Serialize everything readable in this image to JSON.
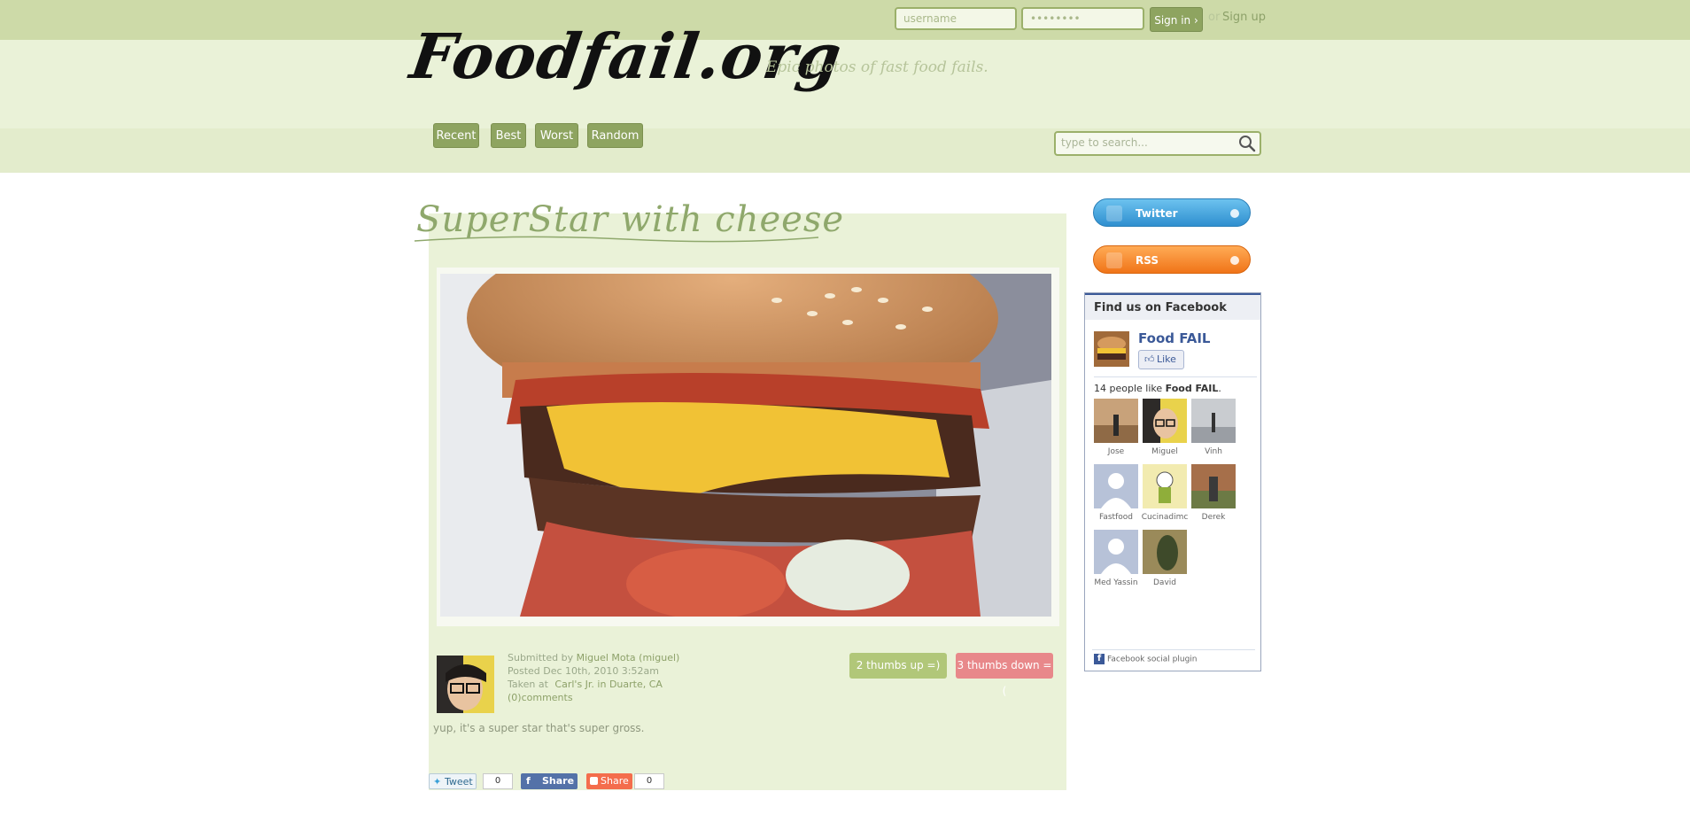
{
  "header": {
    "login": {
      "username_placeholder": "username",
      "password_placeholder": "••••••••",
      "signin_label": "Sign in ›",
      "or_text": "or",
      "signup_label": "Sign up"
    },
    "logo": "Foodfail.org",
    "tagline": "Epic photos of fast food fails.",
    "nav": [
      "Recent",
      "Best",
      "Worst",
      "Random"
    ],
    "search_placeholder": "type to search..."
  },
  "post": {
    "title": "SuperStar with cheese",
    "submitted_by_prefix": "Submitted by",
    "author": "Miguel Mota (miguel)",
    "posted": "Posted Dec 10th, 2010 3:52am",
    "taken_prefix": "Taken at",
    "location": "Carl's Jr. in Duarte, CA",
    "comments": "(0)comments",
    "thumbs_up": "2 thumbs up =)",
    "thumbs_down": "3 thumbs down =(",
    "description": "yup, it's a super star that's super gross.",
    "share": {
      "tweet_label": "Tweet",
      "tweet_count": "0",
      "fb_share_label": "Share",
      "share_label": "Share",
      "share_count": "0"
    }
  },
  "sidebar": {
    "twitter_label": "Twitter",
    "rss_label": "RSS",
    "facebook": {
      "heading": "Find us on Facebook",
      "page_name": "Food FAIL",
      "like_label": "Like",
      "count_prefix": "14 people like",
      "count_page": "Food FAIL",
      "count_suffix": ".",
      "fans": [
        "Jose",
        "Miguel",
        "Vinh",
        "Fastfood",
        "Cucinadimc",
        "Derek",
        "Med Yassin",
        "David"
      ],
      "plugin_label": "Facebook social plugin"
    }
  },
  "colors": {
    "topbar": "#cddaa8",
    "accent_green": "#8ea460",
    "thumbs_up": "#b1c779",
    "thumbs_down": "#e8888a",
    "twitter": "#3fa0d8",
    "rss": "#f5842a",
    "facebook": "#3b5998"
  }
}
